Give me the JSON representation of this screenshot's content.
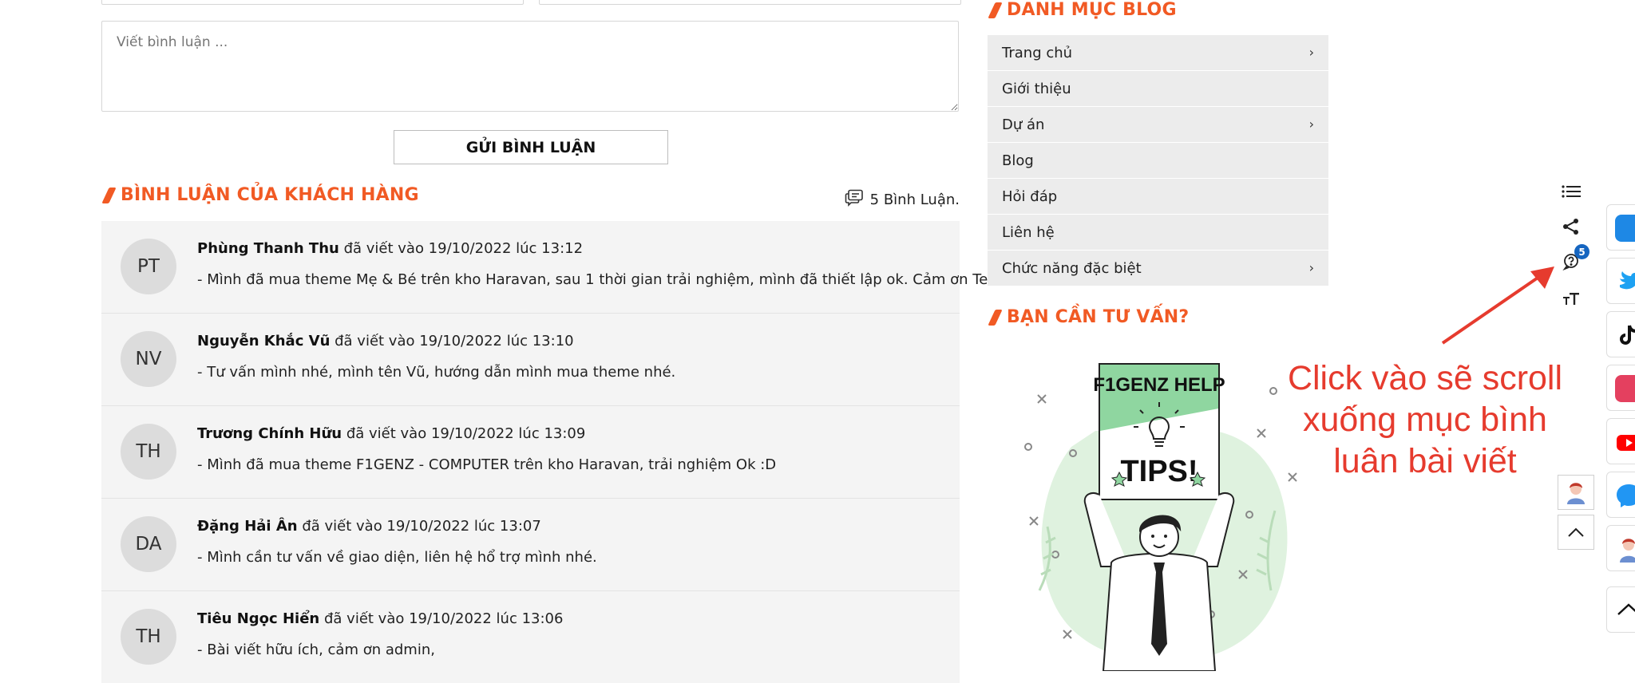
{
  "comment_form": {
    "textarea_placeholder": "Viết bình luận ...",
    "submit_label": "GỬI BÌNH LUẬN"
  },
  "comments_section": {
    "title": "BÌNH LUẬN CỦA KHÁCH HÀNG",
    "count_label": "5 Bình Luận.",
    "items": [
      {
        "initials": "PT",
        "author": "Phùng Thanh Thu",
        "meta": "đã viết vào 19/10/2022 lúc 13:12",
        "text": "- Mình đã mua theme Mẹ & Bé trên kho Haravan, sau 1 thời gian trải nghiệm, mình đã thiết lập ok. Cảm ơn Team."
      },
      {
        "initials": "NV",
        "author": "Nguyễn Khắc Vũ",
        "meta": "đã viết vào 19/10/2022 lúc 13:10",
        "text": "- Tư vấn mình nhé, mình tên Vũ, hướng dẫn mình mua theme nhé."
      },
      {
        "initials": "TH",
        "author": "Trương Chính Hữu",
        "meta": "đã viết vào 19/10/2022 lúc 13:09",
        "text": "- Mình đã mua theme F1GENZ - COMPUTER trên kho Haravan, trải nghiệm Ok :D"
      },
      {
        "initials": "DA",
        "author": "Đặng Hải Ân",
        "meta": "đã viết vào 19/10/2022 lúc 13:07",
        "text": "- Mình cần tư vấn về giao diện, liên hệ hổ trợ mình nhé."
      },
      {
        "initials": "TH",
        "author": "Tiêu Ngọc Hiển",
        "meta": "đã viết vào 19/10/2022 lúc 13:06",
        "text": "- Bài viết hữu ích, cảm ơn admin,"
      }
    ]
  },
  "blog_categories": {
    "title": "DANH MỤC BLOG",
    "items": [
      {
        "label": "Trang chủ",
        "chevron": "›"
      },
      {
        "label": "Giới thiệu",
        "chevron": ""
      },
      {
        "label": "Dự án",
        "chevron": "›"
      },
      {
        "label": "Blog",
        "chevron": ""
      },
      {
        "label": "Hỏi đáp",
        "chevron": ""
      },
      {
        "label": "Liên hệ",
        "chevron": ""
      },
      {
        "label": "Chức năng đặc biệt",
        "chevron": "›"
      }
    ]
  },
  "consult": {
    "title": "BẠN CẦN TƯ VẤN?",
    "sign_top": "F1GENZ HELP",
    "sign_bottom": "TIPS!"
  },
  "annotation": {
    "text": "Click vào sẽ scroll xuống mục bình luân bài viết"
  },
  "toolbar": {
    "comment_badge": "5",
    "icons": [
      "list-icon",
      "share-icon",
      "question-comment-icon",
      "text-size-icon"
    ]
  },
  "social": {
    "items": [
      "zalo-icon",
      "twitter-icon",
      "tiktok-icon",
      "instagram-icon",
      "youtube-icon",
      "messenger-icon",
      "support-avatar-icon",
      "scroll-top-icon"
    ]
  },
  "colors": {
    "accent": "#f15a24",
    "annotation_red": "#e63b2e",
    "menu_bg": "#ececec",
    "comment_bg": "#f4f4f4",
    "badge_blue": "#1565c0"
  }
}
